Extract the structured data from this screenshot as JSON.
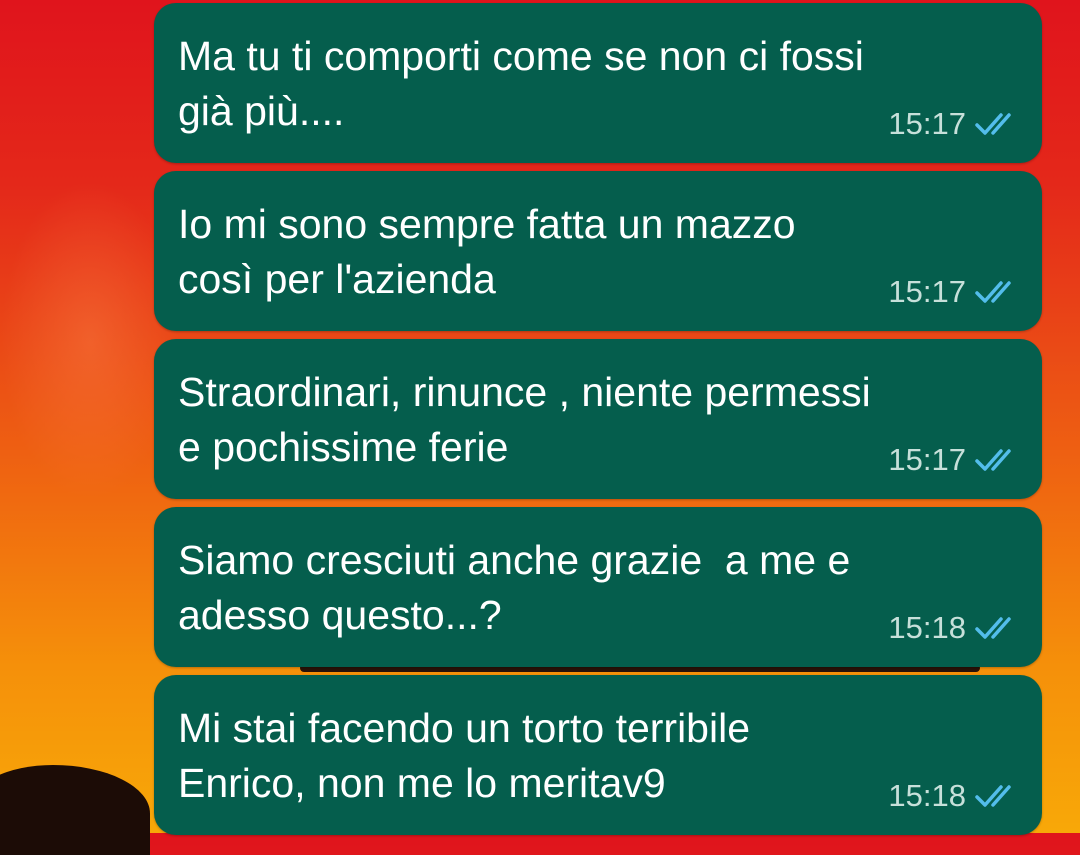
{
  "chat": {
    "messages": [
      {
        "text": "Ma tu ti comporti come se non ci fossi\ngià più....",
        "time": "15:17",
        "status": "read-double-check-icon"
      },
      {
        "text": "Io mi sono sempre fatta un mazzo\ncosì per l'azienda",
        "time": "15:17",
        "status": "read-double-check-icon"
      },
      {
        "text": "Straordinari, rinunce , niente permessi\ne pochissime ferie",
        "time": "15:17",
        "status": "read-double-check-icon"
      },
      {
        "text": "Siamo cresciuti anche grazie  a me e\nadesso questo...?",
        "time": "15:18",
        "status": "read-double-check-icon"
      },
      {
        "text": "Mi stai facendo un torto terribile\nEnrico, non me lo meritav9",
        "time": "15:18",
        "status": "read-double-check-icon"
      }
    ]
  },
  "colors": {
    "bubble_outgoing": "#055e4d",
    "read_tick": "#53bdeb",
    "wallpaper_top": "#e0141c",
    "wallpaper_bottom": "#f8a808"
  }
}
